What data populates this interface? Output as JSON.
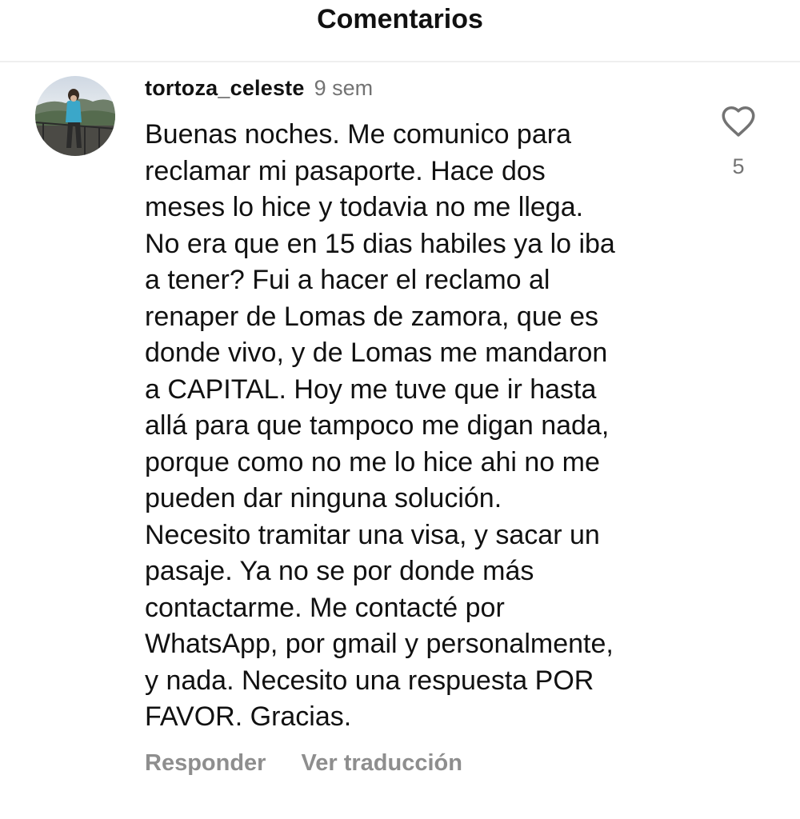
{
  "header": {
    "title": "Comentarios"
  },
  "comment": {
    "avatar_icon": "user-avatar-photo",
    "username": "tortoza_celeste",
    "time": "9 sem",
    "text_lines": [
      "Buenas noches. Me comunico para",
      "reclamar mi pasaporte. Hace dos",
      "meses lo hice y todavia no me llega.",
      "No era que en 15 dias habiles ya lo iba",
      "a tener? Fui a hacer el reclamo al",
      "renaper de Lomas de zamora, que es",
      "donde vivo, y de Lomas me mandaron",
      "a CAPITAL. Hoy me tuve que ir hasta",
      "allá para que tampoco me digan nada,",
      "porque como no me lo hice ahi no me",
      "pueden dar ninguna solución.",
      "Necesito tramitar una visa, y sacar un",
      "pasaje. Ya no se por donde más",
      "contactarme. Me contacté por",
      "WhatsApp, por gmail y personalmente,",
      "y nada. Necesito una respuesta POR",
      "FAVOR. Gracias."
    ],
    "like_icon": "heart-outline-icon",
    "like_count": "5",
    "actions": {
      "reply": "Responder",
      "translate": "Ver traducción"
    }
  },
  "colors": {
    "text": "#111111",
    "secondary": "#737373",
    "action": "#8e8e8e",
    "divider": "#efefef"
  }
}
